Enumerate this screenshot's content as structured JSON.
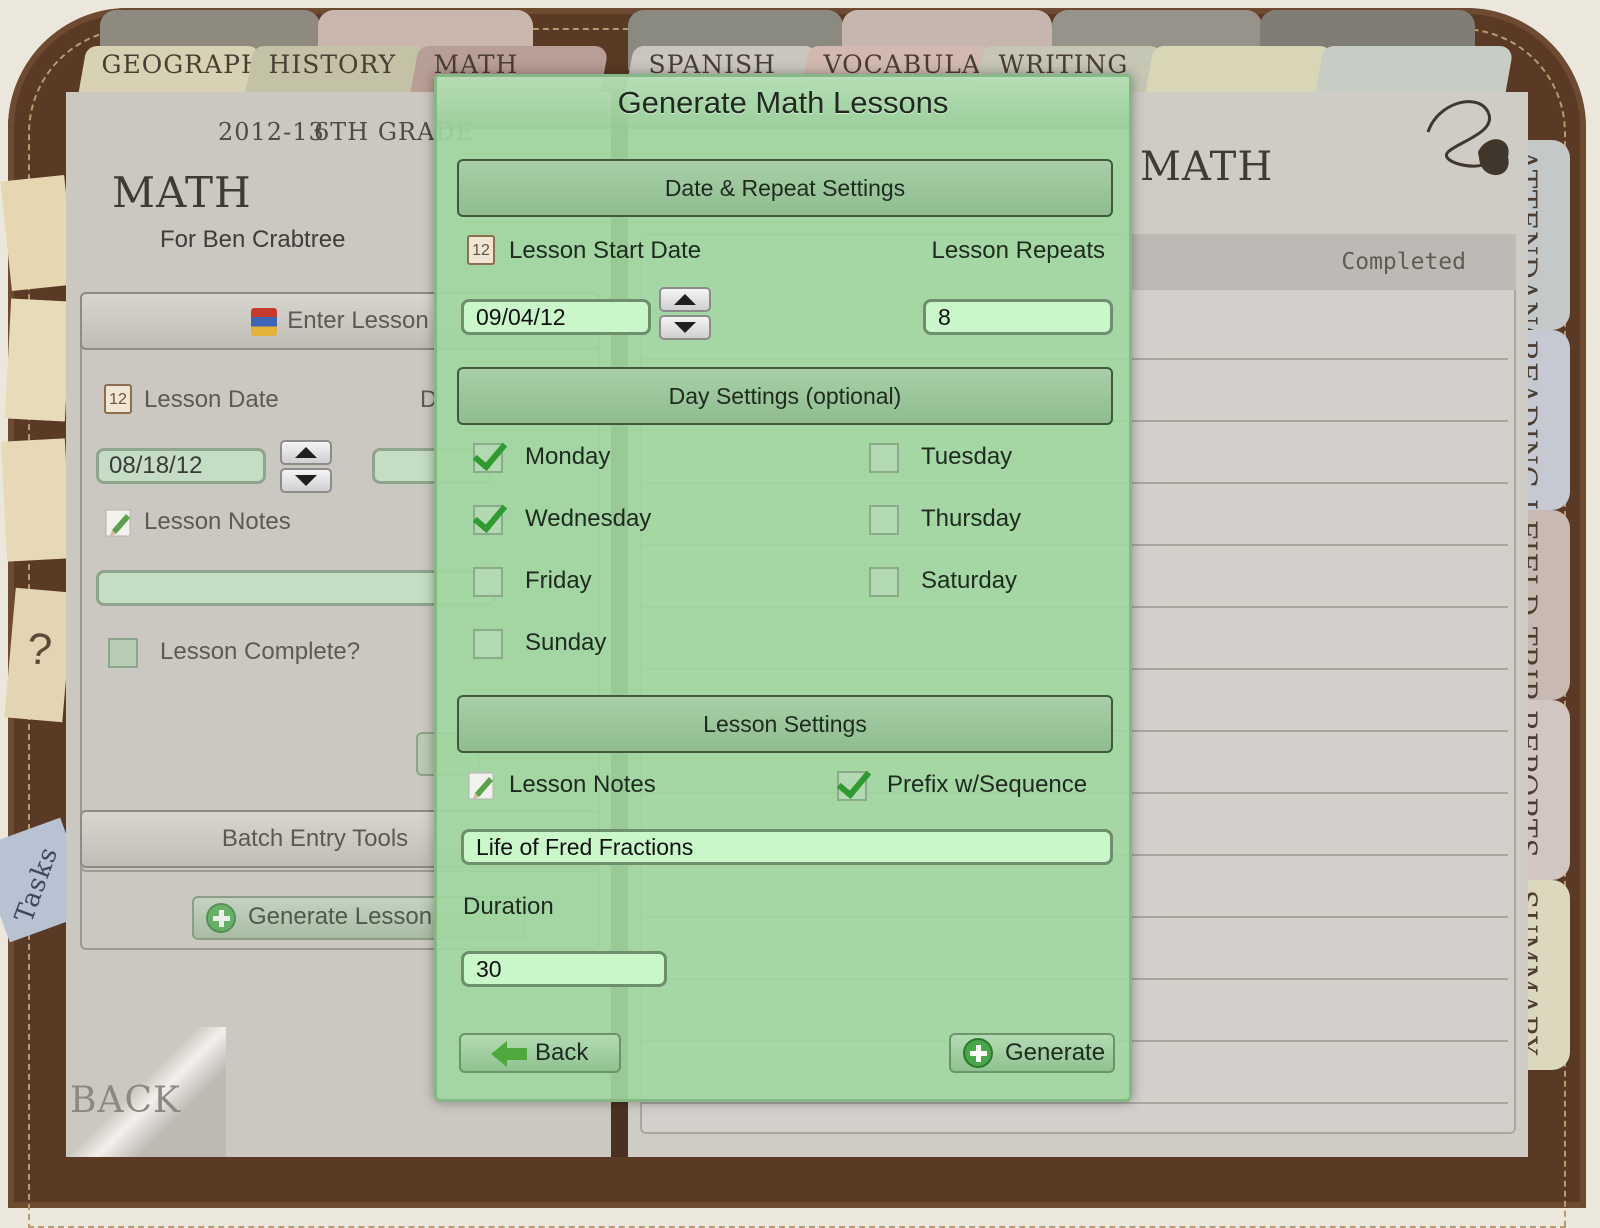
{
  "tabs": {
    "top": [
      "GEOGRAPHY",
      "HISTORY",
      "MATH",
      "SPANISH",
      "VOCABULAR",
      "WRITING"
    ],
    "side": [
      "ATTENDANCE",
      "READING LIST",
      "FIELD TRIPS",
      "REPORTS",
      "SUMMARY"
    ]
  },
  "left_page": {
    "school_year": "2012-13",
    "grade": "6TH GRADE",
    "subject_title": "MATH",
    "student": "For Ben Crabtree",
    "enter_lesson": {
      "header": "Enter Lesson",
      "lesson_date_label": "Lesson Date",
      "lesson_date_value": "08/18/12",
      "duration_label_fragment": "D",
      "lesson_notes_label": "Lesson Notes",
      "lesson_complete_label": "Lesson Complete?"
    },
    "batch": {
      "header": "Batch Entry Tools",
      "generate_button": "Generate Lesson"
    },
    "back_label": "BACK",
    "tasks_label": "Tasks"
  },
  "right_page": {
    "title_fragment": "MATH",
    "completed_header": "Completed"
  },
  "modal": {
    "title": "Generate Math Lessons",
    "date_section": {
      "header": "Date & Repeat Settings",
      "start_date_label": "Lesson Start Date",
      "start_date_value": "09/04/12",
      "repeats_label": "Lesson Repeats",
      "repeats_value": "8",
      "calendar_icon_text": "12"
    },
    "day_section": {
      "header": "Day Settings (optional)",
      "days": {
        "monday": {
          "label": "Monday",
          "checked": true
        },
        "tuesday": {
          "label": "Tuesday",
          "checked": false
        },
        "wednesday": {
          "label": "Wednesday",
          "checked": true
        },
        "thursday": {
          "label": "Thursday",
          "checked": false
        },
        "friday": {
          "label": "Friday",
          "checked": false
        },
        "saturday": {
          "label": "Saturday",
          "checked": false
        },
        "sunday": {
          "label": "Sunday",
          "checked": false
        }
      }
    },
    "lesson_section": {
      "header": "Lesson Settings",
      "notes_label": "Lesson Notes",
      "prefix_label": "Prefix w/Sequence",
      "prefix_checked": true,
      "notes_value": "Life of Fred Fractions",
      "duration_label": "Duration",
      "duration_value": "30"
    },
    "buttons": {
      "back": "Back",
      "generate": "Generate"
    }
  },
  "colors": {
    "binder": "#5a3a24",
    "modal_green": "#a0d7a0",
    "field_green": "#c9f7c9"
  }
}
